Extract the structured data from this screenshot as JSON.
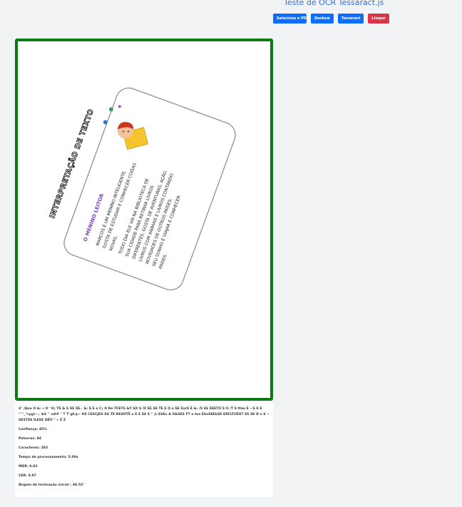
{
  "header": {
    "title": "Teste de OCR Tessaract.js"
  },
  "toolbar": {
    "select_pdf": "Selecione o PDF",
    "deskew": "Deskew",
    "tesseract": "Tesseract",
    "clear": "Limpar"
  },
  "image": {
    "heading": "INTERPRETAÇÃO DE TEXTO",
    "story_title": "O MENINO LEITOR",
    "lines": [
      "MARCOS É UM MENINO INTELIGENTE,",
      "GOSTA DE ESTUDAR E CONHECER COISAS",
      "NOVAS.",
      "TODO DIA ELE VAI NA BIBLIOTECA DE",
      "SUA CIDADE PARA RETIRAR LIVROS",
      "DIFERENTES, GOSTA DE AVENTURAS, AÇÃO,",
      "LIVROS COM ANIMAIS E LIVROS CONTANDO",
      "NOVIDADES DE OUTROS PAÍSES.",
      "SEU SONHO É VIAJAR E CONHECER",
      "PAÍSES."
    ]
  },
  "result": {
    "ocr_text": "4° /Ano O &: « 9 ' O¡ TS & S SS SS.. &: S E o C¡ O Re TFETS &Y SX S /II SE SS TE E Q o SE SxrS É &: /S SS SSETO S O /T S ttão É ~S S S \"\"\"_\"cyg)~.. &S \" :aê# \" T T\"gf.q— KS CESCJES SG TE RESOTÉ o E E SS S \" ;L ESEv & S&SES FT e tos ESoSSEkSE ERFLTUÉST SS SS D o S ~ SESTSS ILESE QÉO \" « Z Z",
    "metrics": [
      {
        "label": "Confiança:",
        "value": "45%"
      },
      {
        "label": "Palavras:",
        "value": "84"
      },
      {
        "label": "Caracteres:",
        "value": "283"
      },
      {
        "label": "Tempo de processamento:",
        "value": "5.00s"
      },
      {
        "label": "WER:",
        "value": "0.82"
      },
      {
        "label": "CER:",
        "value": "0.97"
      },
      {
        "label": "Ângulo de inclinação inicial :",
        "value": "40.52°"
      }
    ]
  },
  "colors": {
    "accent": "#0d6efd",
    "danger": "#dc3545",
    "frame": "#0b7a12",
    "title": "#2e6fd8"
  }
}
